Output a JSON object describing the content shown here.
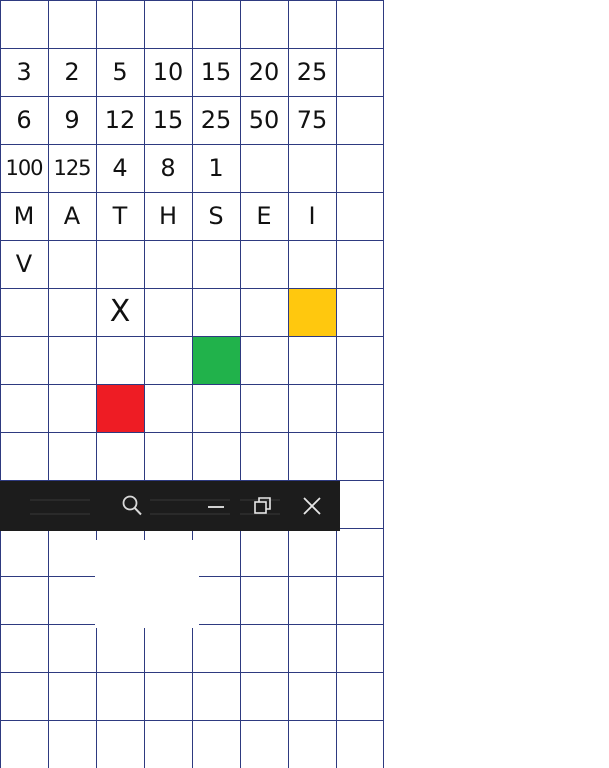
{
  "board": {
    "rows": [
      [
        "",
        "",
        "",
        "",
        "",
        "",
        "",
        ""
      ],
      [
        "3",
        "2",
        "5",
        "10",
        "15",
        "20",
        "25",
        ""
      ],
      [
        "6",
        "9",
        "12",
        "15",
        "25",
        "50",
        "75",
        ""
      ],
      [
        "100",
        "125",
        "4",
        "8",
        "1",
        "",
        "",
        ""
      ],
      [
        "M",
        "A",
        "T",
        "H",
        "S",
        "E",
        "I",
        ""
      ],
      [
        "V",
        "",
        "",
        "",
        "",
        "",
        "",
        ""
      ],
      [
        "",
        "",
        "X",
        "",
        "",
        "",
        "",
        ""
      ]
    ],
    "tiles": [
      {
        "name": "yellow-tile",
        "color": "#ffc80e",
        "row": 6,
        "col": 6
      },
      {
        "name": "green-tile",
        "color": "#21b24b",
        "row": 7,
        "col": 4
      },
      {
        "name": "red-tile",
        "color": "#ee1c24",
        "row": 8,
        "col": 2
      }
    ],
    "line_color": "#2e3a80"
  },
  "window_controls": {
    "search": "search-icon",
    "minimize": "minimize-icon",
    "restore": "restore-icon",
    "close": "close-icon",
    "bar_color": "#1c1c1c"
  }
}
